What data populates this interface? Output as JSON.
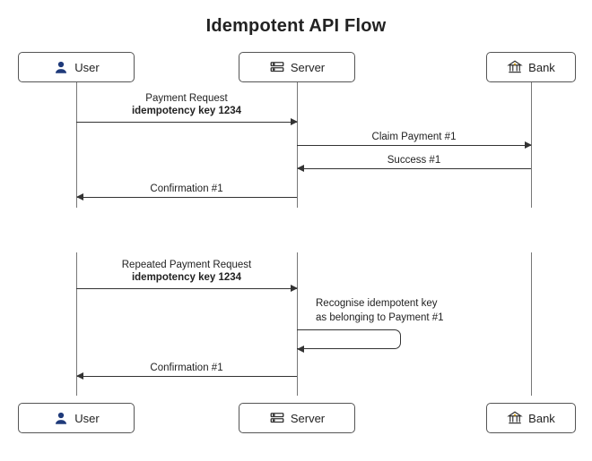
{
  "title": "Idempotent API Flow",
  "actors": {
    "user": {
      "label": "User"
    },
    "server": {
      "label": "Server"
    },
    "bank": {
      "label": "Bank"
    }
  },
  "chart_data": {
    "type": "sequence-diagram",
    "title": "Idempotent API Flow",
    "participants": [
      "User",
      "Server",
      "Bank"
    ],
    "segments": [
      {
        "messages": [
          {
            "from": "User",
            "to": "Server",
            "text": "Payment Request",
            "detail": "idempotency key 1234"
          },
          {
            "from": "Server",
            "to": "Bank",
            "text": "Claim Payment #1"
          },
          {
            "from": "Bank",
            "to": "Server",
            "text": "Success #1"
          },
          {
            "from": "Server",
            "to": "User",
            "text": "Confirmation #1"
          }
        ]
      },
      {
        "messages": [
          {
            "from": "User",
            "to": "Server",
            "text": "Repeated Payment Request",
            "detail": "idempotency key 1234"
          },
          {
            "from": "Server",
            "to": "Server",
            "note": "Recognise idempotent key\nas belonging to Payment #1"
          },
          {
            "from": "Server",
            "to": "User",
            "text": "Confirmation #1"
          }
        ]
      }
    ]
  },
  "messages": {
    "seg1": {
      "m1_line1": "Payment Request",
      "m1_line2": "idempotency key 1234",
      "m2": "Claim Payment #1",
      "m3": "Success #1",
      "m4": "Confirmation #1"
    },
    "seg2": {
      "m1_line1": "Repeated Payment Request",
      "m1_line2": "idempotency key 1234",
      "note_l1": "Recognise idempotent key",
      "note_l2": "as belonging to Payment #1",
      "m3": "Confirmation #1"
    }
  }
}
